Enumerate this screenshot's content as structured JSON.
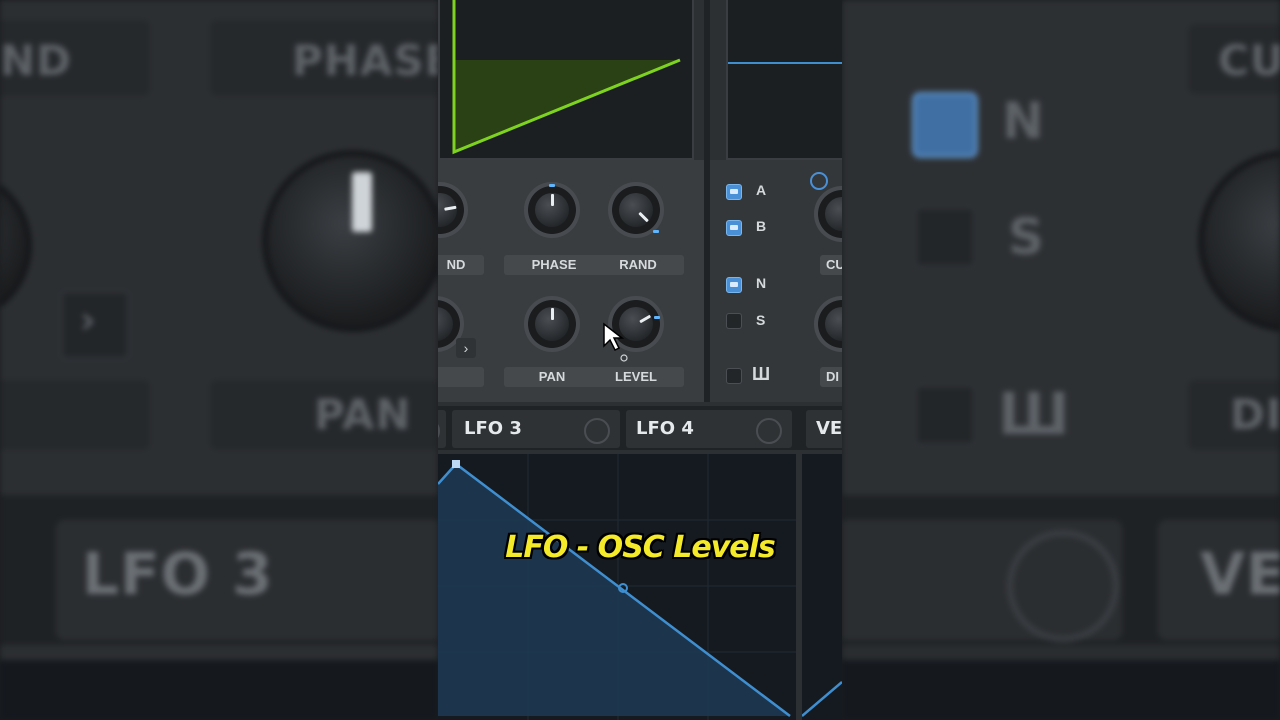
{
  "caption": "LFO - OSC Levels",
  "osc": {
    "knobs_row1": [
      "ND",
      "PHASE",
      "RAND"
    ],
    "knobs_row2": [
      "PAN",
      "LEVEL"
    ],
    "arrow": "›"
  },
  "noise": {
    "checks": [
      {
        "label": "A",
        "checked": true
      },
      {
        "label": "B",
        "checked": true
      },
      {
        "label": "N",
        "checked": true
      },
      {
        "label": "S",
        "checked": false
      }
    ],
    "keys_label": "Ш",
    "knob_labels": [
      "CU",
      "DI"
    ]
  },
  "tabs": [
    "LFO 3",
    "LFO 4",
    "VEL"
  ],
  "background": {
    "left_top": [
      "ND",
      "PHASE"
    ],
    "left_bottom": "PAN",
    "left_tab": "LFO 3",
    "left_arrow": "›",
    "right_checks": [
      "N",
      "S"
    ],
    "right_keys": "Ш",
    "right_top": "CU",
    "right_bottom": "DI",
    "right_tab": "VEL"
  },
  "colors": {
    "wave_green": "#7ed321",
    "lfo_blue": "#3f8fd0",
    "accent": "#4a90d6",
    "caption": "#f4ea2a"
  }
}
